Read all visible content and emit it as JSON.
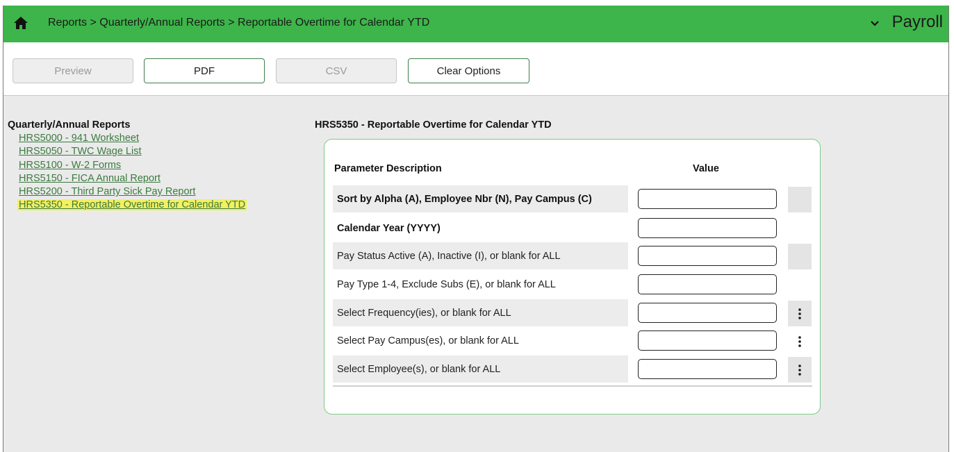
{
  "header": {
    "breadcrumb": "Reports > Quarterly/Annual Reports > Reportable Overtime for Calendar YTD",
    "module": "Payroll",
    "brand_color": "#3db54a"
  },
  "toolbar": {
    "preview_label": "Preview",
    "pdf_label": "PDF",
    "csv_label": "CSV",
    "clear_label": "Clear Options"
  },
  "sidebar": {
    "title": "Quarterly/Annual Reports",
    "items": [
      {
        "label": "HRS5000 - 941 Worksheet"
      },
      {
        "label": "HRS5050 - TWC Wage List"
      },
      {
        "label": "HRS5100 - W-2 Forms"
      },
      {
        "label": "HRS5150 - FICA Annual Report"
      },
      {
        "label": "HRS5200 - Third Party Sick Pay Report"
      },
      {
        "label": "HRS5350 - Reportable Overtime for Calendar YTD"
      }
    ],
    "active_index": 5,
    "highlight_color": "#f4f060"
  },
  "main": {
    "title": "HRS5350 - Reportable Overtime for Calendar YTD",
    "col_description": "Parameter Description",
    "col_value": "Value",
    "params": [
      {
        "label": "Sort by Alpha (A), Employee Nbr (N), Pay Campus (C)",
        "value": ""
      },
      {
        "label": "Calendar Year (YYYY)",
        "value": ""
      },
      {
        "label": "Pay Status Active (A), Inactive (I), or blank for ALL",
        "value": ""
      },
      {
        "label": "Pay Type 1-4, Exclude Subs (E), or blank for ALL",
        "value": ""
      },
      {
        "label": "Select Frequency(ies), or blank for ALL",
        "value": ""
      },
      {
        "label": "Select Pay Campus(es), or blank for ALL",
        "value": ""
      },
      {
        "label": "Select Employee(s), or blank for ALL",
        "value": ""
      }
    ]
  }
}
